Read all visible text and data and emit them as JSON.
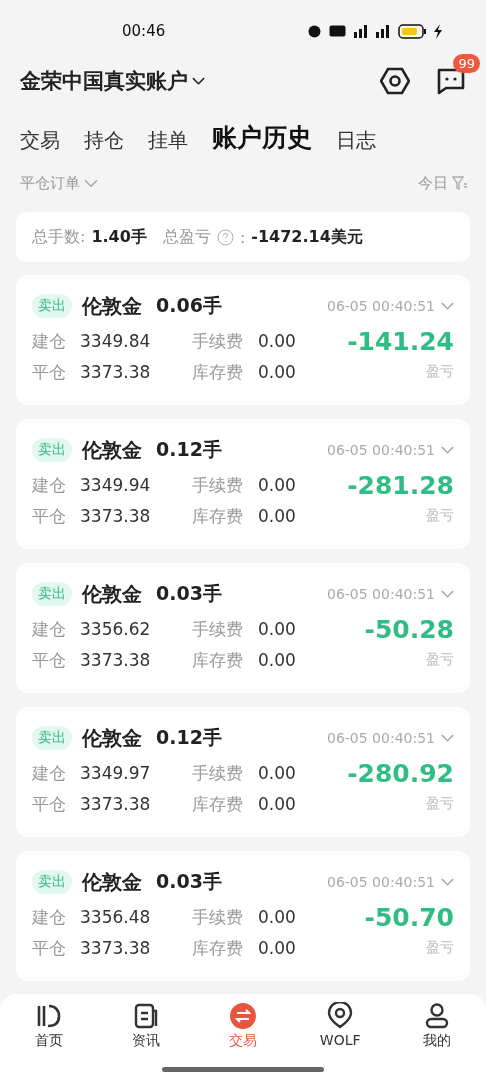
{
  "status_bar": {
    "time": "00:46"
  },
  "header": {
    "account": "金荣中国真实账户",
    "badge": "99"
  },
  "tabs": [
    {
      "label": "交易",
      "selected": false
    },
    {
      "label": "持仓",
      "selected": false
    },
    {
      "label": "挂单",
      "selected": false
    },
    {
      "label": "账户历史",
      "selected": true
    },
    {
      "label": "日志",
      "selected": false
    }
  ],
  "filter": {
    "type": "平仓订单",
    "date": "今日"
  },
  "summary": {
    "lots_label": "总手数:",
    "lots": "1.40手",
    "pl_label": "总盈亏",
    "pl_colon": ":",
    "pl": "-1472.14美元"
  },
  "orders": [
    {
      "side": "卖出",
      "symbol": "伦敦金",
      "lots": "0.06手",
      "time": "06-05 00:40:51",
      "open_label": "建仓",
      "open": "3349.84",
      "close_label": "平仓",
      "close": "3373.38",
      "fee_label": "手续费",
      "fee": "0.00",
      "swap_label": "库存费",
      "swap": "0.00",
      "profit": "-141.24",
      "profit_label": "盈亏"
    },
    {
      "side": "卖出",
      "symbol": "伦敦金",
      "lots": "0.12手",
      "time": "06-05 00:40:51",
      "open_label": "建仓",
      "open": "3349.94",
      "close_label": "平仓",
      "close": "3373.38",
      "fee_label": "手续费",
      "fee": "0.00",
      "swap_label": "库存费",
      "swap": "0.00",
      "profit": "-281.28",
      "profit_label": "盈亏"
    },
    {
      "side": "卖出",
      "symbol": "伦敦金",
      "lots": "0.03手",
      "time": "06-05 00:40:51",
      "open_label": "建仓",
      "open": "3356.62",
      "close_label": "平仓",
      "close": "3373.38",
      "fee_label": "手续费",
      "fee": "0.00",
      "swap_label": "库存费",
      "swap": "0.00",
      "profit": "-50.28",
      "profit_label": "盈亏"
    },
    {
      "side": "卖出",
      "symbol": "伦敦金",
      "lots": "0.12手",
      "time": "06-05 00:40:51",
      "open_label": "建仓",
      "open": "3349.97",
      "close_label": "平仓",
      "close": "3373.38",
      "fee_label": "手续费",
      "fee": "0.00",
      "swap_label": "库存费",
      "swap": "0.00",
      "profit": "-280.92",
      "profit_label": "盈亏"
    },
    {
      "side": "卖出",
      "symbol": "伦敦金",
      "lots": "0.03手",
      "time": "06-05 00:40:51",
      "open_label": "建仓",
      "open": "3356.48",
      "close_label": "平仓",
      "close": "3373.38",
      "fee_label": "手续费",
      "fee": "0.00",
      "swap_label": "库存费",
      "swap": "0.00",
      "profit": "-50.70",
      "profit_label": "盈亏"
    }
  ],
  "nav": [
    {
      "kind": "home",
      "label": "首页",
      "selected": false
    },
    {
      "kind": "news",
      "label": "资讯",
      "selected": false
    },
    {
      "kind": "trade",
      "label": "交易",
      "selected": true
    },
    {
      "kind": "wolf",
      "label": "WOLF",
      "selected": false
    },
    {
      "kind": "me",
      "label": "我的",
      "selected": false
    }
  ]
}
